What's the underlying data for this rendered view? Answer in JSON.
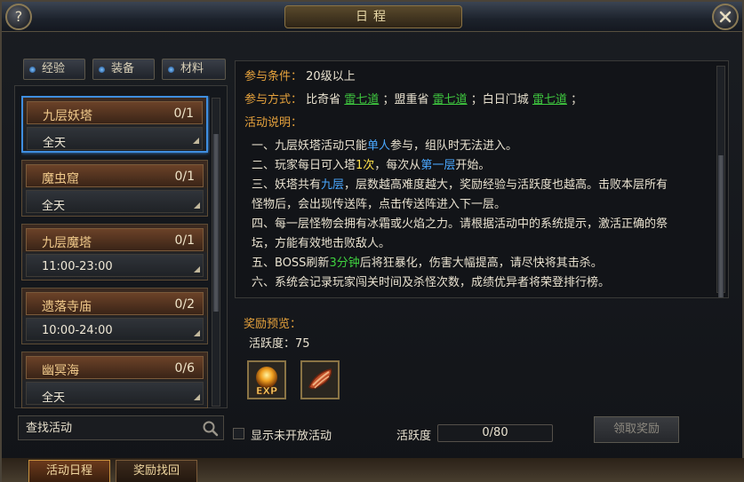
{
  "window": {
    "title": "日程"
  },
  "filters": [
    {
      "label": "经验"
    },
    {
      "label": "装备"
    },
    {
      "label": "材料"
    }
  ],
  "events": [
    {
      "name": "九层妖塔",
      "count": "0/1",
      "time": "全天",
      "selected": true
    },
    {
      "name": "魔虫窟",
      "count": "0/1",
      "time": "全天"
    },
    {
      "name": "九层魔塔",
      "count": "0/1",
      "time": "11:00-23:00"
    },
    {
      "name": "遗落寺庙",
      "count": "0/2",
      "time": "10:00-24:00"
    },
    {
      "name": "幽冥海",
      "count": "0/6",
      "time": "全天"
    }
  ],
  "search": {
    "placeholder": "查找活动"
  },
  "detail": {
    "condition_label": "参与条件：",
    "condition_value": "20级以上",
    "method_label": "参与方式：",
    "method_parts": [
      "比奇省",
      "雷七道",
      "；盟重省",
      "雷七道",
      "；白日门城",
      "雷七道",
      "；"
    ],
    "desc_label": "活动说明：",
    "desc": [
      [
        "一、九层妖塔活动只能",
        "单人",
        "参与，组队时无法进入。"
      ],
      [
        "二、玩家每日可入塔",
        "1次",
        "，每次从",
        "第一层",
        "开始。"
      ],
      [
        "三、妖塔共有",
        "九层",
        "，层数越高难度越大，奖励经验与活跃度也越高。击败本层所有"
      ],
      [
        "怪物后，会出现传送阵，点击传送阵进入下一层。"
      ],
      [
        "四、每一层怪物会拥有冰霜或火焰之力。请根据活动中的系统提示，激活正确的祭"
      ],
      [
        "坛，方能有效地击败敌人。"
      ],
      [
        "五、BOSS刷新",
        "3分钟",
        "后将狂暴化，伤害大幅提高，请尽快将其击杀。"
      ],
      [
        "六、系统会记录玩家闯关时间及杀怪次数，成绩优异者将荣登排行榜。"
      ]
    ]
  },
  "reward": {
    "title": "奖励预览：",
    "activity": "活跃度：75",
    "items": [
      {
        "icon": "exp-orb-icon",
        "label": "EXP"
      },
      {
        "icon": "bacon-meat-icon"
      }
    ]
  },
  "footer": {
    "checkbox_label": "显示未开放活动",
    "progress_label": "活跃度",
    "progress_text": "0/80",
    "progress_value": 0,
    "claim_label": "领取奖励"
  },
  "tabs": [
    {
      "label": "活动日程",
      "active": true
    },
    {
      "label": "奖励找回"
    }
  ],
  "colors": {
    "accent_orange": "#e6a23c",
    "link_green": "#3fc93f",
    "highlight_blue": "#4aa8ff",
    "highlight_yellow": "#ffe14a",
    "selected_border": "#3f8ee0"
  }
}
